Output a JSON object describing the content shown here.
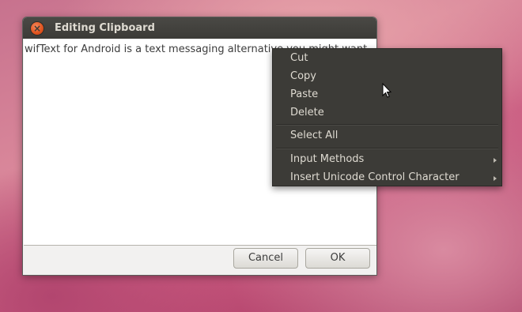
{
  "window": {
    "title": "Editing Clipboard",
    "close_icon": "close-icon"
  },
  "editor": {
    "text": "wifText for Android is a text messaging alternative you might want"
  },
  "scrollbar": {
    "thumb_grip": "⋮⋮⋮"
  },
  "buttons": {
    "cancel": "Cancel",
    "ok": "OK"
  },
  "context_menu": {
    "cut": "Cut",
    "copy": "Copy",
    "paste": "Paste",
    "delete": "Delete",
    "select_all": "Select All",
    "input_methods": "Input Methods",
    "insert_unicode": "Insert Unicode Control Character"
  },
  "colors": {
    "title_bar": "#3c3b37",
    "close_button": "#e0531e",
    "menu_bg": "#3c3b37",
    "menu_text": "#dfdbd2"
  }
}
